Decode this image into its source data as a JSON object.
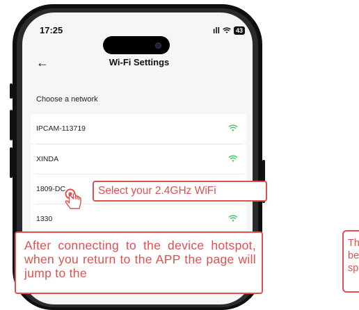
{
  "status_bar": {
    "time": "17:25",
    "signal": "ıll",
    "wifi": "wifi-icon",
    "battery": "43"
  },
  "header": {
    "back_icon": "arrow-left-icon",
    "title": "Wi-Fi Settings"
  },
  "network_section": {
    "label": "Choose a network"
  },
  "networks": [
    {
      "name": "IPCAM-113719",
      "signal_icon": "wifi-icon"
    },
    {
      "name": "XINDA",
      "signal_icon": "wifi-icon"
    },
    {
      "name": "1809-DC",
      "signal_icon": "wifi-icon"
    },
    {
      "name": "1330",
      "signal_icon": "wifi-icon"
    }
  ],
  "annotations": {
    "select_wifi": "Select your 2.4GHz WiFi",
    "after_connecting": "After connecting to the device hotspot, when you return to the APP the page will jump to the",
    "right_partial": "Th be sp"
  },
  "colors": {
    "accent": "#e0504f",
    "wifi_green": "#40c463",
    "screen_bg": "#f6f6f6"
  }
}
